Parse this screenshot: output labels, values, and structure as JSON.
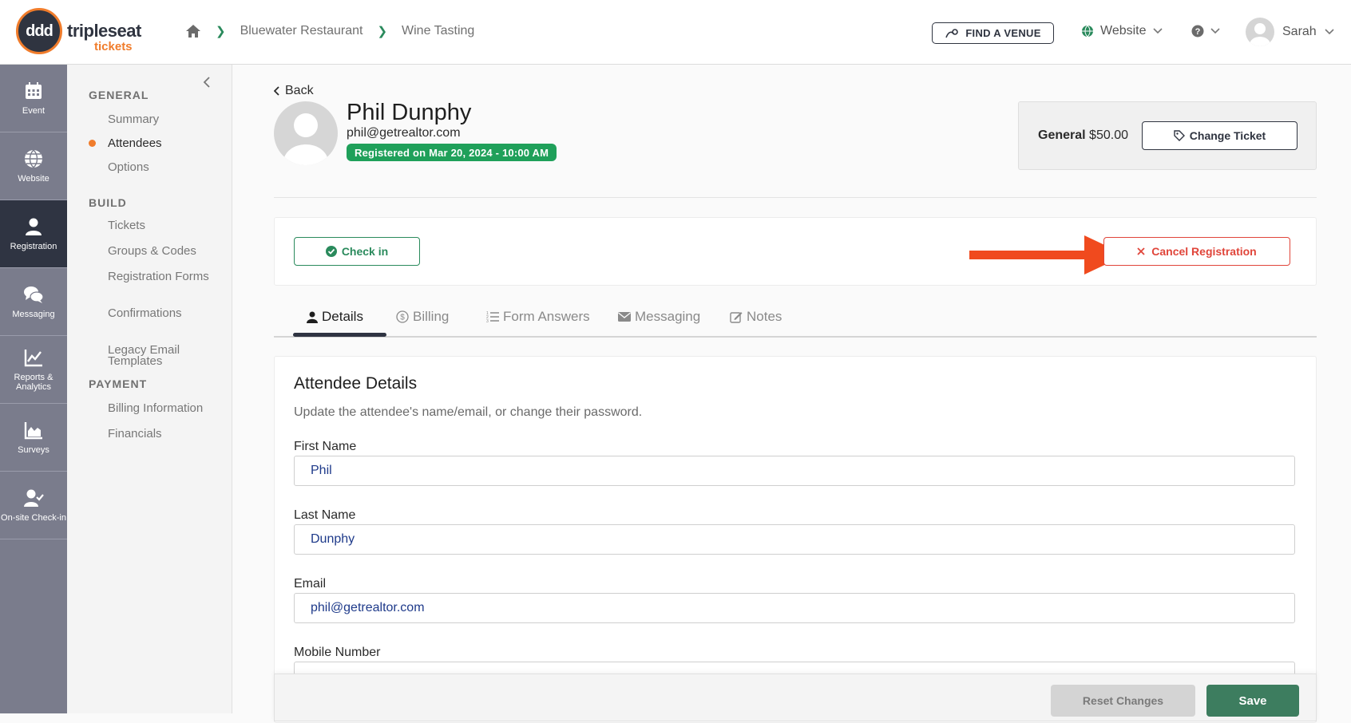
{
  "brand": {
    "name": "tripleseat",
    "sub": "tickets",
    "mark": "ddd"
  },
  "breadcrumb": {
    "items": [
      "Bluewater Restaurant",
      "Wine Tasting"
    ]
  },
  "header": {
    "find_venue": "FIND A VENUE",
    "website": "Website",
    "user": "Sarah"
  },
  "rail": {
    "items": [
      {
        "label": "Event",
        "icon": "calendar-icon"
      },
      {
        "label": "Website",
        "icon": "globe-icon"
      },
      {
        "label": "Registration",
        "icon": "person-icon",
        "active": true
      },
      {
        "label": "Messaging",
        "icon": "chat-icon"
      },
      {
        "label": "Reports & Analytics",
        "icon": "chart-line-icon"
      },
      {
        "label": "Surveys",
        "icon": "chart-area-icon"
      },
      {
        "label": "On-site Check-in",
        "icon": "user-check-icon"
      }
    ]
  },
  "subnav": {
    "general": "GENERAL",
    "summary": "Summary",
    "attendees": "Attendees",
    "options": "Options",
    "build": "BUILD",
    "tickets": "Tickets",
    "groups": "Groups & Codes",
    "reg_forms": "Registration Forms",
    "confirmations": "Confirmations",
    "legacy": "Legacy Email Templates",
    "payment": "PAYMENT",
    "billing_info": "Billing Information",
    "financials": "Financials"
  },
  "attendee": {
    "back": "Back",
    "name": "Phil Dunphy",
    "email": "phil@getrealtor.com",
    "registered": "Registered on Mar 20, 2024 - 10:00 AM"
  },
  "ticket": {
    "type": "General",
    "price": "$50.00",
    "change": "Change Ticket"
  },
  "actions": {
    "checkin": "Check in",
    "cancel": "Cancel Registration"
  },
  "tabs": [
    "Details",
    "Billing",
    "Form Answers",
    "Messaging",
    "Notes"
  ],
  "details": {
    "title": "Attendee Details",
    "subtitle": "Update the attendee's name/email, or change their password.",
    "first_name_label": "First Name",
    "first_name": "Phil",
    "last_name_label": "Last Name",
    "last_name": "Dunphy",
    "email_label": "Email",
    "email": "phil@getrealtor.com",
    "mobile_label": "Mobile Number"
  },
  "footer": {
    "reset": "Reset Changes",
    "save": "Save"
  },
  "colors": {
    "brand_orange": "#f07c2b",
    "success": "#1fa05a",
    "danger": "#e0453a",
    "rail": "#7a7c8c",
    "rail_active": "#2f3442"
  }
}
